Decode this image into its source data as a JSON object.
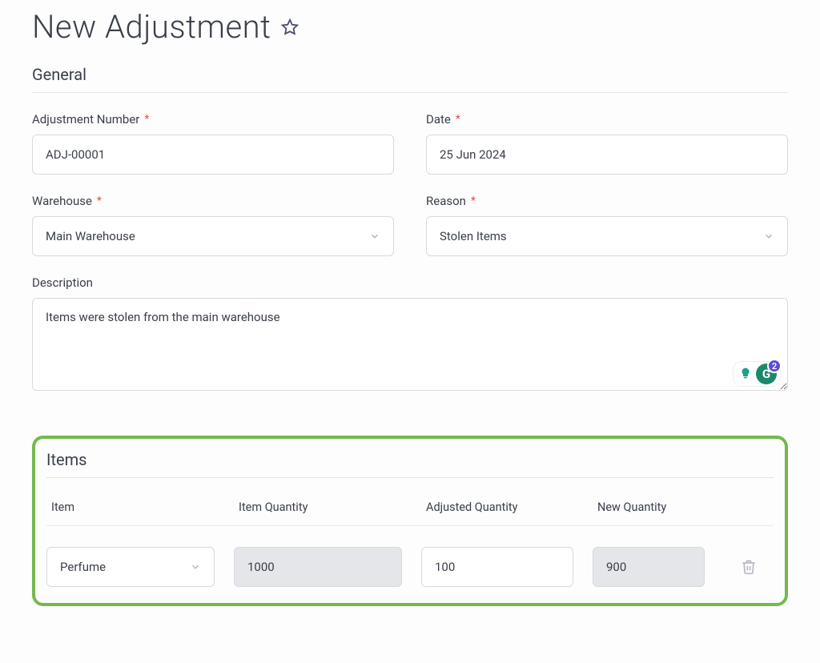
{
  "page": {
    "title": "New Adjustment"
  },
  "sections": {
    "general": {
      "title": "General"
    },
    "items": {
      "title": "Items"
    }
  },
  "general": {
    "adjustment_number": {
      "label": "Adjustment Number",
      "value": "ADJ-00001",
      "required": true
    },
    "date": {
      "label": "Date",
      "value": "25 Jun 2024",
      "required": true
    },
    "warehouse": {
      "label": "Warehouse",
      "value": "Main Warehouse",
      "required": true
    },
    "reason": {
      "label": "Reason",
      "value": "Stolen Items",
      "required": true
    },
    "description": {
      "label": "Description",
      "value": "Items were stolen from the main warehouse"
    }
  },
  "items_table": {
    "headers": {
      "item": "Item",
      "item_qty": "Item Quantity",
      "adj_qty": "Adjusted Quantity",
      "new_qty": "New Quantity"
    },
    "rows": [
      {
        "item": "Perfume",
        "item_qty": "1000",
        "adj_qty": "100",
        "new_qty": "900"
      }
    ]
  },
  "grammarly": {
    "letter": "G",
    "count": "2"
  },
  "required_marker": "*"
}
